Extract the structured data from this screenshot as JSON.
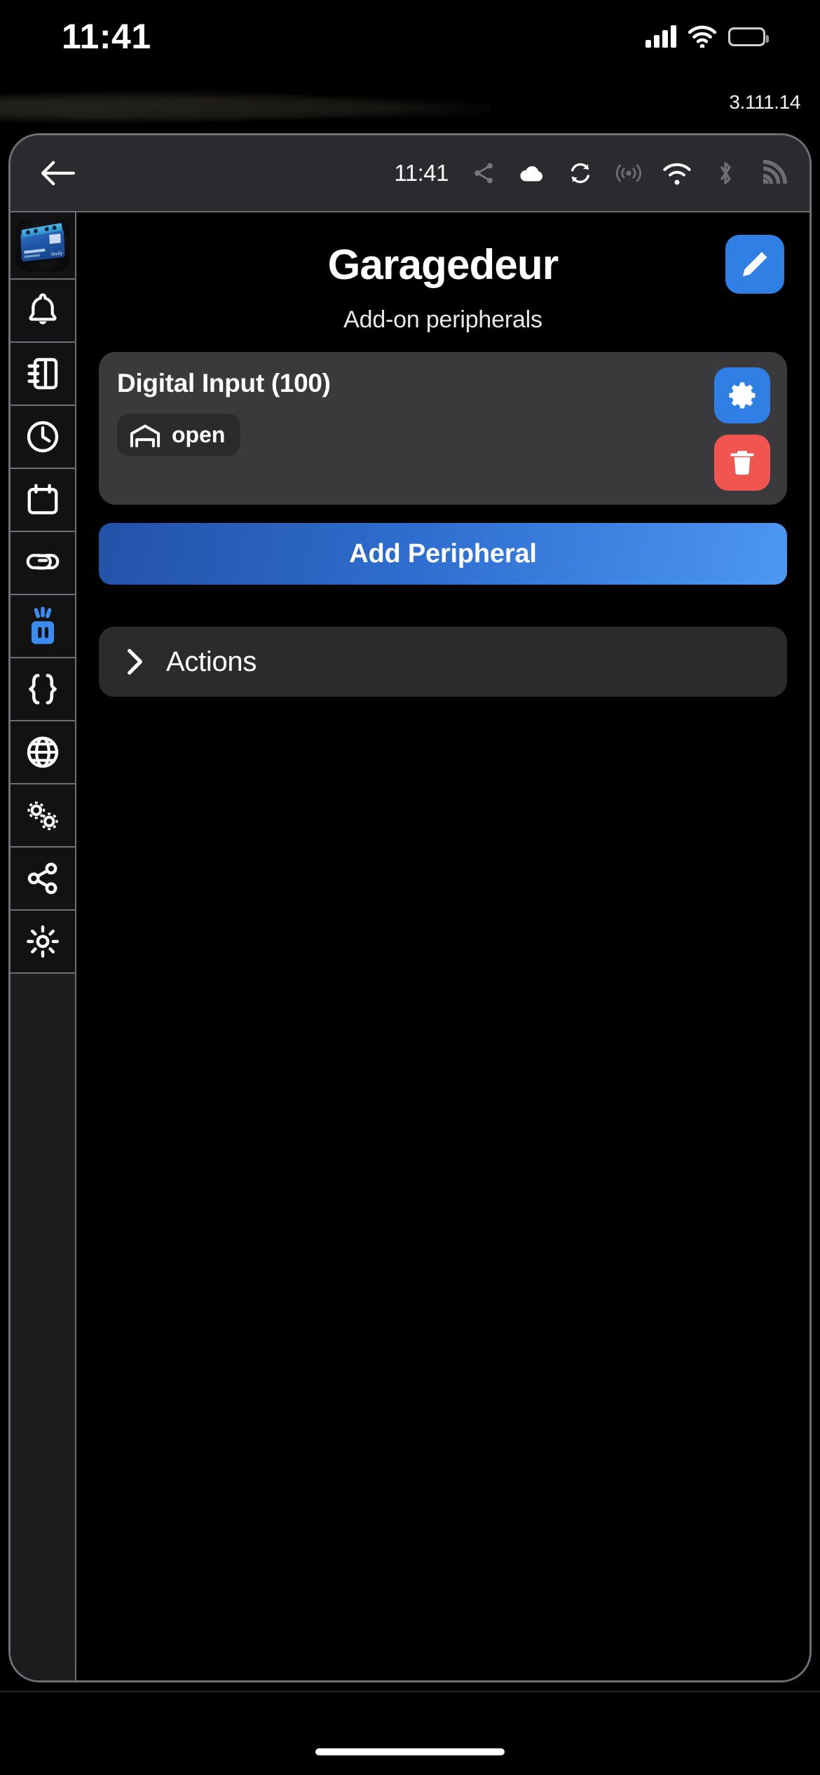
{
  "ios_status": {
    "time": "11:41",
    "cellular_icon": "cellular-signal-icon",
    "wifi_icon": "wifi-icon",
    "battery_icon": "battery-icon"
  },
  "version": "3.111.14",
  "app_toolbar": {
    "back_icon": "back-arrow-icon",
    "time": "11:41",
    "icons": [
      {
        "name": "share-nodes-icon",
        "state": "inactive"
      },
      {
        "name": "cloud-icon",
        "state": "active"
      },
      {
        "name": "sync-refresh-icon",
        "state": "active"
      },
      {
        "name": "broadcast-icon",
        "state": "inactive"
      },
      {
        "name": "wifi-icon",
        "state": "active"
      },
      {
        "name": "bluetooth-icon",
        "state": "inactive"
      },
      {
        "name": "rss-signal-icon",
        "state": "inactive"
      }
    ]
  },
  "sidebar": {
    "items": [
      {
        "name": "device-thumbnail",
        "icon": "shelly-device-image",
        "active": false
      },
      {
        "name": "notifications",
        "icon": "bell-icon",
        "active": false
      },
      {
        "name": "logs",
        "icon": "notebook-icon",
        "active": false
      },
      {
        "name": "schedule",
        "icon": "clock-icon",
        "active": false
      },
      {
        "name": "calendar",
        "icon": "calendar-icon",
        "active": false
      },
      {
        "name": "links",
        "icon": "link-chain-icon",
        "active": false
      },
      {
        "name": "peripherals",
        "icon": "peripheral-device-icon",
        "active": true
      },
      {
        "name": "json",
        "icon": "braces-icon",
        "active": false
      },
      {
        "name": "network",
        "icon": "globe-icon",
        "active": false
      },
      {
        "name": "advanced",
        "icon": "gears-icon",
        "active": false
      },
      {
        "name": "sharing",
        "icon": "share-nodes-icon",
        "active": false
      },
      {
        "name": "settings",
        "icon": "gear-icon",
        "active": false
      }
    ]
  },
  "main": {
    "title": "Garagedeur",
    "subtitle": "Add-on peripherals",
    "edit_icon": "pencil-icon",
    "peripheral": {
      "title": "Digital Input (100)",
      "state_icon": "garage-door-icon",
      "state_label": "open",
      "settings_icon": "gear-icon",
      "delete_icon": "trash-icon"
    },
    "add_peripheral_label": "Add Peripheral",
    "actions": {
      "label": "Actions",
      "chevron_icon": "chevron-right-icon"
    }
  },
  "colors": {
    "accent_blue": "#2f7fe4",
    "danger_red": "#f1554f",
    "card_gray": "#3a3a3c",
    "panel_gray": "#2b2b2d",
    "window_border": "#6c6f75"
  }
}
